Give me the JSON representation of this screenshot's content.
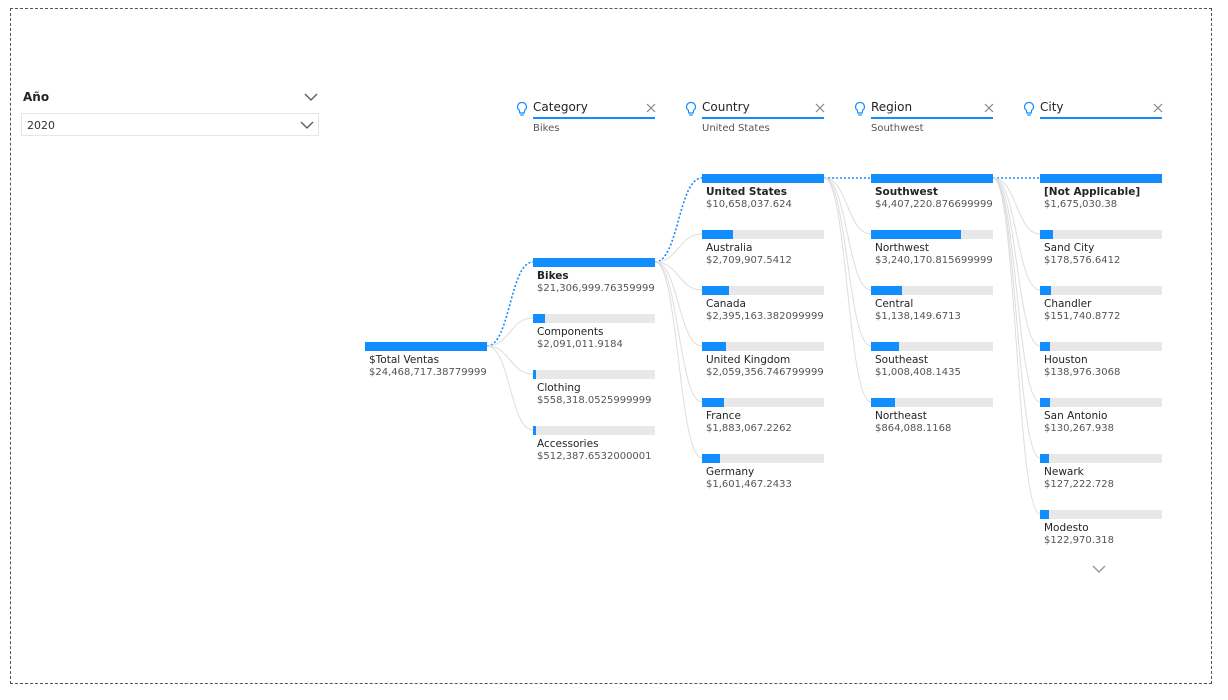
{
  "slicer": {
    "title": "Año",
    "selected_value": "2020"
  },
  "tree": {
    "root": {
      "label": "$Total Ventas",
      "value": "$24,468,717.38779999",
      "fraction": 1.0
    },
    "columns": [
      {
        "header": "Category",
        "selection": "Bikes",
        "nodes": [
          {
            "label": "Bikes",
            "value": "$21,306,999.76359999",
            "fraction": 1.0,
            "selected": true
          },
          {
            "label": "Components",
            "value": "$2,091,011.9184",
            "fraction": 0.098,
            "selected": false
          },
          {
            "label": "Clothing",
            "value": "$558,318.0525999999",
            "fraction": 0.026,
            "selected": false
          },
          {
            "label": "Accessories",
            "value": "$512,387.6532000001",
            "fraction": 0.024,
            "selected": false
          }
        ]
      },
      {
        "header": "Country",
        "selection": "United States",
        "nodes": [
          {
            "label": "United States",
            "value": "$10,658,037.624",
            "fraction": 1.0,
            "selected": true
          },
          {
            "label": "Australia",
            "value": "$2,709,907.5412",
            "fraction": 0.254,
            "selected": false
          },
          {
            "label": "Canada",
            "value": "$2,395,163.382099999",
            "fraction": 0.225,
            "selected": false
          },
          {
            "label": "United Kingdom",
            "value": "$2,059,356.746799999",
            "fraction": 0.193,
            "selected": false
          },
          {
            "label": "France",
            "value": "$1,883,067.2262",
            "fraction": 0.177,
            "selected": false
          },
          {
            "label": "Germany",
            "value": "$1,601,467.2433",
            "fraction": 0.15,
            "selected": false
          }
        ]
      },
      {
        "header": "Region",
        "selection": "Southwest",
        "nodes": [
          {
            "label": "Southwest",
            "value": "$4,407,220.876699999",
            "fraction": 1.0,
            "selected": true
          },
          {
            "label": "Northwest",
            "value": "$3,240,170.815699999",
            "fraction": 0.735,
            "selected": false
          },
          {
            "label": "Central",
            "value": "$1,138,149.6713",
            "fraction": 0.258,
            "selected": false
          },
          {
            "label": "Southeast",
            "value": "$1,008,408.1435",
            "fraction": 0.229,
            "selected": false
          },
          {
            "label": "Northeast",
            "value": "$864,088.1168",
            "fraction": 0.196,
            "selected": false
          }
        ]
      },
      {
        "header": "City",
        "selection": "",
        "nodes": [
          {
            "label": "[Not Applicable]",
            "value": "$1,675,030.38",
            "fraction": 1.0,
            "selected": true
          },
          {
            "label": "Sand City",
            "value": "$178,576.6412",
            "fraction": 0.107,
            "selected": false
          },
          {
            "label": "Chandler",
            "value": "$151,740.8772",
            "fraction": 0.091,
            "selected": false
          },
          {
            "label": "Houston",
            "value": "$138,976.3068",
            "fraction": 0.083,
            "selected": false
          },
          {
            "label": "San Antonio",
            "value": "$130,267.938",
            "fraction": 0.078,
            "selected": false
          },
          {
            "label": "Newark",
            "value": "$127,222.728",
            "fraction": 0.076,
            "selected": false
          },
          {
            "label": "Modesto",
            "value": "$122,970.318",
            "fraction": 0.073,
            "selected": false
          }
        ]
      }
    ]
  },
  "colors": {
    "accent": "#118DFF",
    "track": "#E8E8E8",
    "link": "#DDDDDD"
  },
  "icons": {
    "slicer_toggle": "chevron-down-icon",
    "header_insight": "lightbulb-icon",
    "header_remove": "close-icon",
    "show_more": "chevron-down-icon"
  }
}
